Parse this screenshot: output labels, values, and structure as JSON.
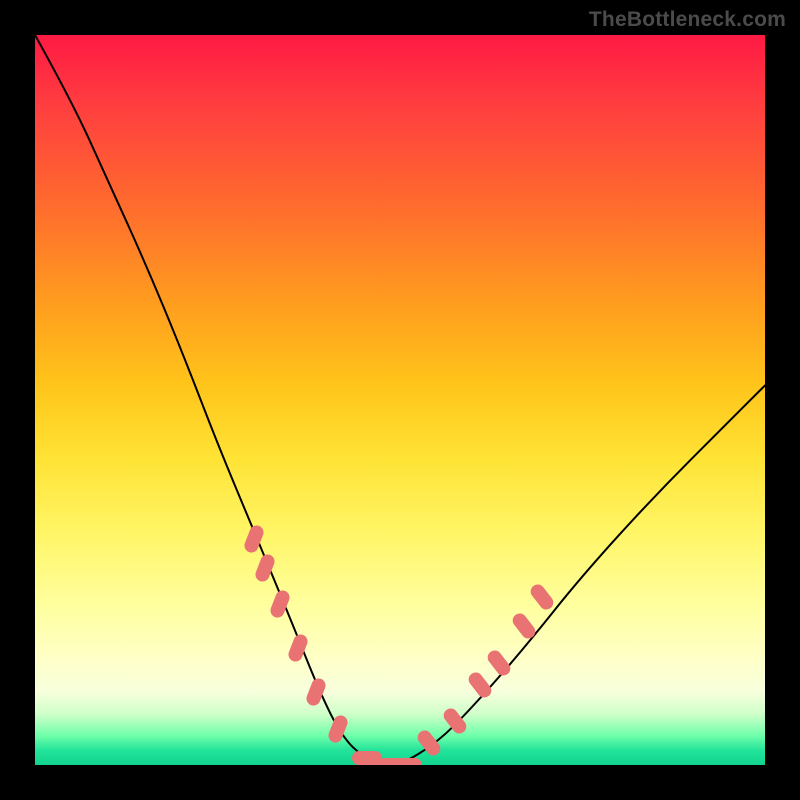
{
  "watermark": "TheBottleneck.com",
  "colors": {
    "background": "#000000",
    "curve_stroke": "#000000",
    "segment_fill": "#e97272"
  },
  "chart_data": {
    "type": "line",
    "title": "",
    "xlabel": "",
    "ylabel": "",
    "xlim": [
      0,
      100
    ],
    "ylim": [
      0,
      100
    ],
    "grid": false,
    "series": [
      {
        "name": "bottleneck-curve",
        "x": [
          0,
          5,
          10,
          15,
          20,
          25,
          30,
          35,
          39,
          42,
          45,
          48,
          50,
          55,
          60,
          67,
          75,
          85,
          95,
          100
        ],
        "y": [
          100,
          91,
          80,
          69,
          57,
          44,
          32,
          20,
          10,
          4,
          1,
          0,
          0,
          3,
          8,
          16,
          26,
          37,
          47,
          52
        ]
      }
    ],
    "annotations": {
      "highlighted_segments": [
        {
          "branch": "left",
          "x": 30.0,
          "y": 31
        },
        {
          "branch": "left",
          "x": 31.5,
          "y": 27
        },
        {
          "branch": "left",
          "x": 33.5,
          "y": 22
        },
        {
          "branch": "left",
          "x": 36.0,
          "y": 16
        },
        {
          "branch": "left",
          "x": 38.5,
          "y": 10
        },
        {
          "branch": "left",
          "x": 41.5,
          "y": 5
        },
        {
          "branch": "flat",
          "x": 45.5,
          "y": 1
        },
        {
          "branch": "flat",
          "x": 48.5,
          "y": 0
        },
        {
          "branch": "flat",
          "x": 51.0,
          "y": 0
        },
        {
          "branch": "right",
          "x": 54.0,
          "y": 3
        },
        {
          "branch": "right",
          "x": 57.5,
          "y": 6
        },
        {
          "branch": "right",
          "x": 61.0,
          "y": 11
        },
        {
          "branch": "right",
          "x": 63.5,
          "y": 14
        },
        {
          "branch": "right",
          "x": 67.0,
          "y": 19
        },
        {
          "branch": "right",
          "x": 69.5,
          "y": 23
        }
      ]
    }
  }
}
